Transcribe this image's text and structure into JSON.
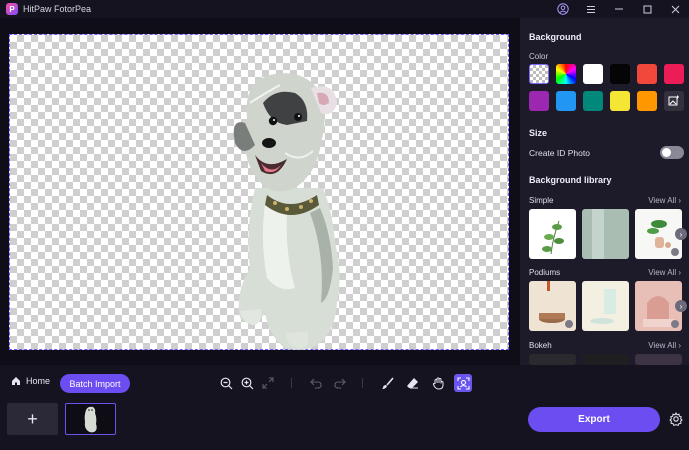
{
  "app": {
    "title": "HitPaw FotorPea"
  },
  "panel": {
    "background_title": "Background",
    "color_label": "Color",
    "colors": [
      "transparent",
      "rainbow",
      "#ffffff",
      "#050505",
      "#f2473b",
      "#ec1c56",
      "#9c27b0",
      "#2196f3",
      "#00897b",
      "#f5e535",
      "#ff9800",
      "custom"
    ],
    "size_title": "Size",
    "create_id_label": "Create ID Photo",
    "create_id_enabled": false,
    "library_title": "Background library",
    "categories": [
      {
        "name": "Simple",
        "view_all": "View All"
      },
      {
        "name": "Podiums",
        "view_all": "View All"
      },
      {
        "name": "Bokeh",
        "view_all": "View All"
      }
    ]
  },
  "toolbar": {
    "home_label": "Home",
    "batch_label": "Batch Import",
    "tools": [
      "zoom-out",
      "zoom-in",
      "fit-screen",
      "undo",
      "redo",
      "brush",
      "eraser",
      "hand",
      "ai-select"
    ]
  },
  "bottom": {
    "add_label": "+",
    "export_label": "Export"
  },
  "accent": "#6b4df2"
}
